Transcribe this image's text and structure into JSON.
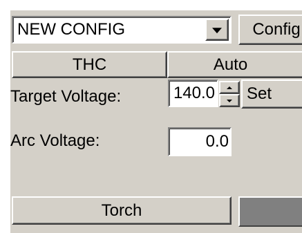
{
  "config_select": {
    "value": "NEW CONFIG",
    "dropdown_icon": "chevron-down-icon"
  },
  "buttons": {
    "config": "Config",
    "thc": "THC",
    "auto": "Auto",
    "set": "Set",
    "torch": "Torch"
  },
  "labels": {
    "target_voltage": "Target Voltage:",
    "arc_voltage": "Arc Voltage:"
  },
  "fields": {
    "target_voltage_value": "140.0",
    "arc_voltage_value": "0.0"
  },
  "spinner": {
    "up_icon": "arrow-up-icon",
    "down_icon": "arrow-down-icon"
  },
  "colors": {
    "panel_bg": "#d4d0c8",
    "torch_indicator": "#808080"
  }
}
